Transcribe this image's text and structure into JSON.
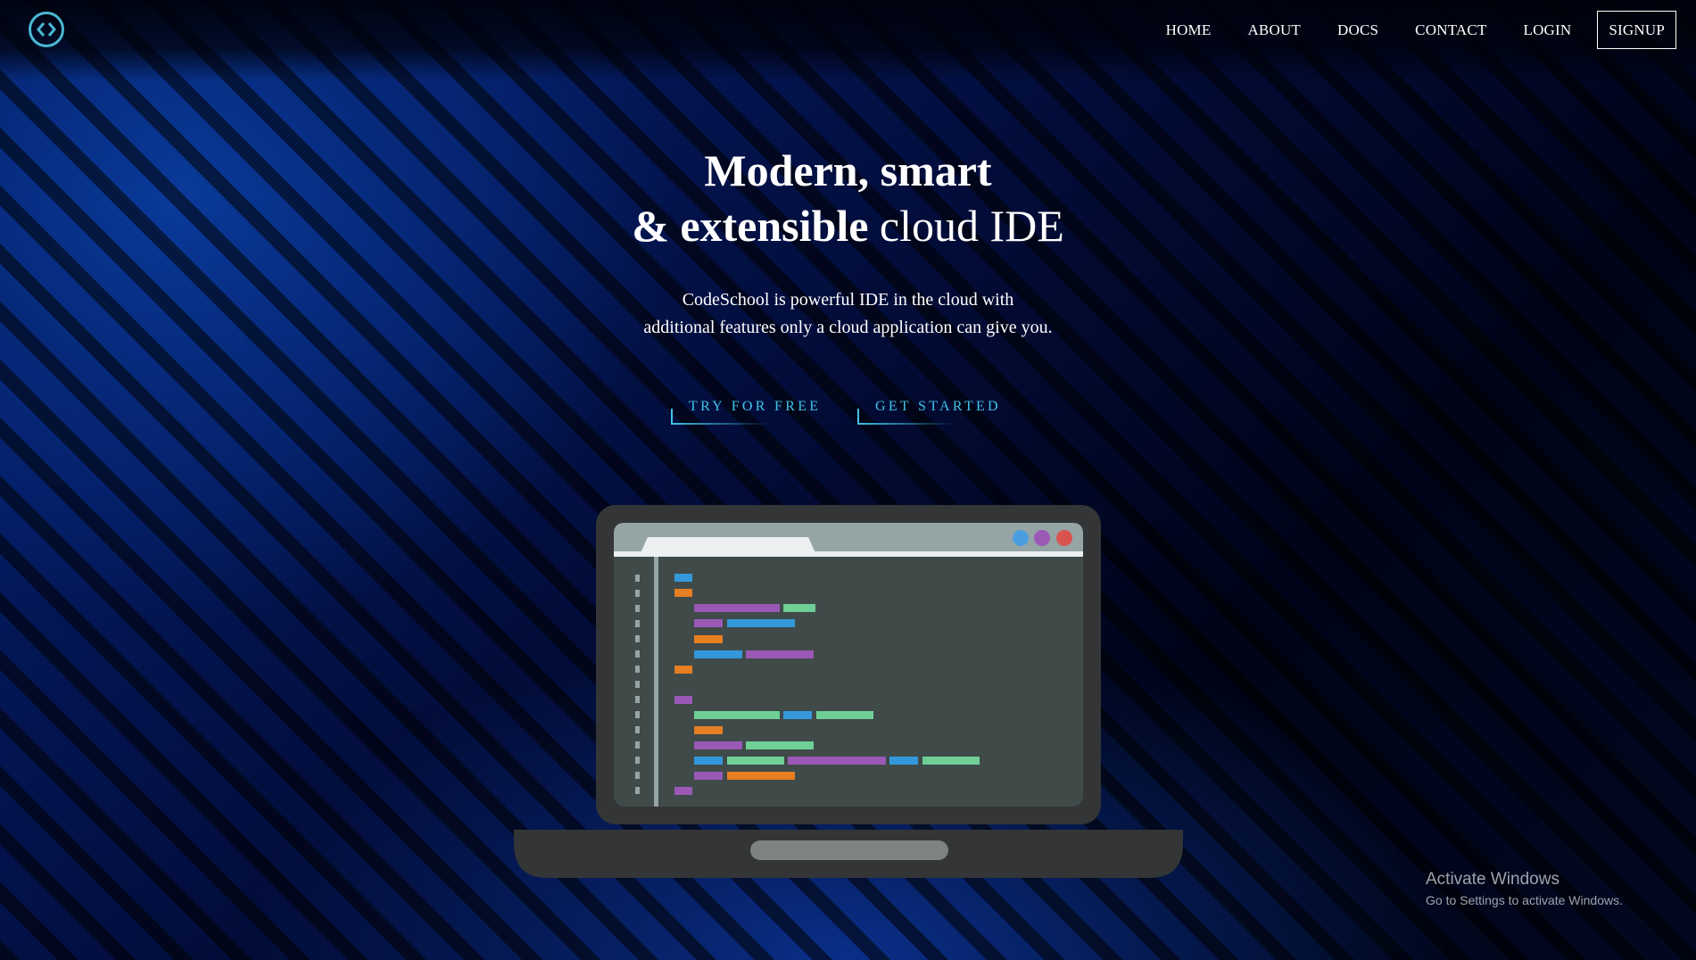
{
  "nav": {
    "logo_icon": "code-brackets-icon",
    "links": [
      "HOME",
      "ABOUT",
      "DOCS",
      "CONTACT",
      "LOGIN"
    ],
    "signup_label": "SIGNUP"
  },
  "hero": {
    "title_line1": "Modern, smart",
    "title_line2_bold": "& extensible",
    "title_line2_light": "cloud IDE",
    "subtitle_line1": "CodeSchool is powerful IDE in the cloud with",
    "subtitle_line2": "additional features only a cloud application can give you."
  },
  "cta": {
    "try_label": "TRY FOR FREE",
    "start_label": "GET STARTED"
  },
  "illustration": {
    "name": "laptop-code-editor-illustration",
    "window_dots": [
      "#4a9ee0",
      "#9b59b6",
      "#d9534f"
    ]
  },
  "watermark": {
    "title": "Activate Windows",
    "subtitle": "Go to Settings to activate Windows."
  },
  "colors": {
    "accent": "#3fc4e8",
    "background": "#000826"
  }
}
